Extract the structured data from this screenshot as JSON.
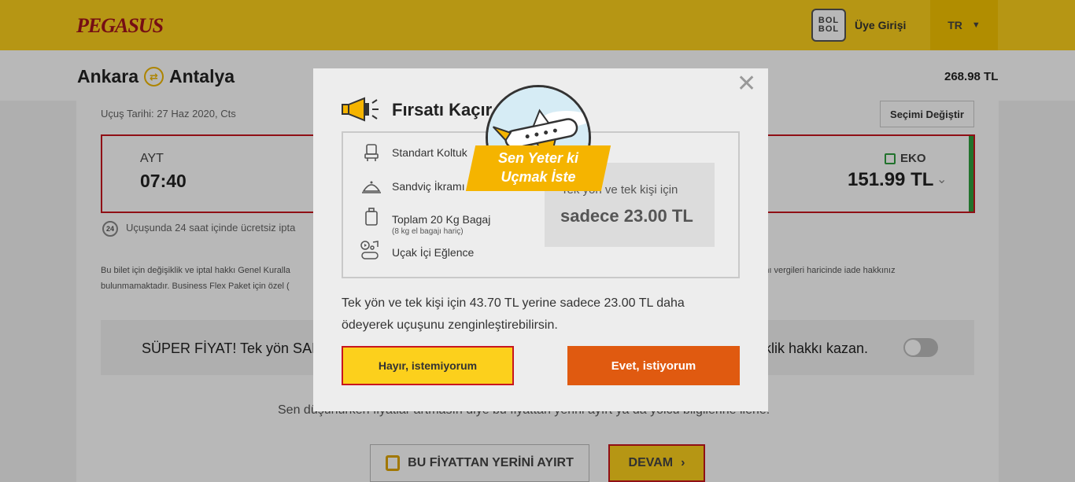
{
  "header": {
    "logo": "PEGASUS",
    "bolbol_line1": "BOL",
    "bolbol_line2": "BOL",
    "login_label": "Üye Girişi",
    "language": "TR"
  },
  "route": {
    "from": "Ankara",
    "to": "Antalya",
    "total_price": "268.98 TL"
  },
  "flight": {
    "date_label": "Uçuş Tarihi: 27 Haz 2020, Cts",
    "change_label": "Seçimi Değiştir",
    "airport": "AYT",
    "time": "07:40",
    "fare_class": "EKO",
    "fare_price": "151.99 TL",
    "cancel_badge": "24",
    "cancel_text": "Uçuşunda 24 saat içinde ücretsiz ipta"
  },
  "rules": {
    "line1": "Bu bilet için değişiklik ve iptal hakkı Genel Kuralla",
    "line1_right": "manı vergileri haricinde iade hakkınız",
    "line2": "bulunmamaktadır. Business Flex Paket için özel ("
  },
  "super_offer": {
    "left_text": "SÜPER FİYAT! Tek yön SAD",
    "right_text": "şiklik hakkı kazan."
  },
  "bottom": {
    "note": "Sen düşünürken fiyatlar artmasın diye bu fiyattan yerini ayırt ya da yolcu bilgilerine ilerle.",
    "reserve_label": "BU FİYATTAN YERİNİ AYIRT",
    "continue_label": "DEVAM"
  },
  "modal": {
    "close": "✕",
    "title": "Fırsatı Kaçır",
    "features": [
      {
        "label": "Standart Koltuk"
      },
      {
        "label": "Sandviç İkramı"
      },
      {
        "label": "Toplam 20 Kg Bagaj",
        "sub": "(8 kg el bagajı hariç)"
      },
      {
        "label": "Uçak İçi Eğlence"
      }
    ],
    "price_line1": "Tek yön ve tek kişi için",
    "price_line2": "sadece 23.00 TL",
    "description": "Tek yön ve tek kişi için 43.70 TL yerine sadece 23.00 TL daha ödeyerek uçuşunu zenginleştirebilirsin.",
    "no_label": "Hayır, istemiyorum",
    "yes_label": "Evet, istiyorum",
    "badge_line1": "Sen Yeter ki",
    "badge_line2": "Uçmak İste"
  },
  "colors": {
    "brand_yellow": "#fcd01c",
    "brand_red": "#c8161e",
    "cta_orange": "#e05a10",
    "eko_green": "#2e9e3e"
  }
}
